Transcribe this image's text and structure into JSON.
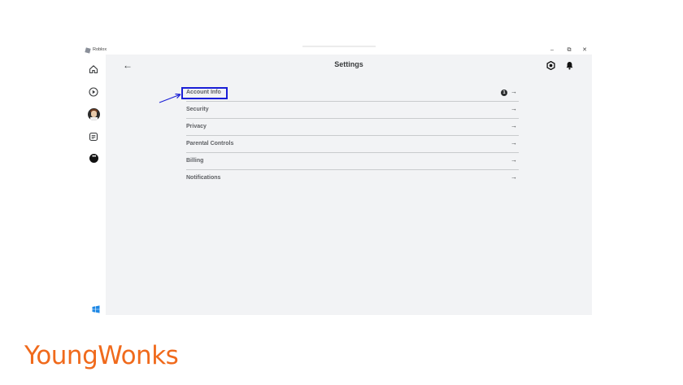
{
  "window": {
    "title": "Roblox",
    "controls": {
      "minimize": "–",
      "maximize": "⧉",
      "close": "✕"
    }
  },
  "sidebar": {
    "items": [
      "home-icon",
      "play-icon",
      "avatar",
      "chat-icon",
      "more-icon"
    ],
    "more_label": "•••"
  },
  "header": {
    "back": "←",
    "title": "Settings"
  },
  "settings": {
    "items": [
      {
        "label": "Account Info",
        "badge": "1",
        "arrow": "→"
      },
      {
        "label": "Security",
        "arrow": "→"
      },
      {
        "label": "Privacy",
        "arrow": "→"
      },
      {
        "label": "Parental Controls",
        "arrow": "→"
      },
      {
        "label": "Billing",
        "arrow": "→"
      },
      {
        "label": "Notifications",
        "arrow": "→"
      }
    ]
  },
  "annotation": {
    "highlight_color": "#1a1fd6"
  },
  "brand": {
    "name": "YoungWonks",
    "color": "#f06a1c"
  }
}
